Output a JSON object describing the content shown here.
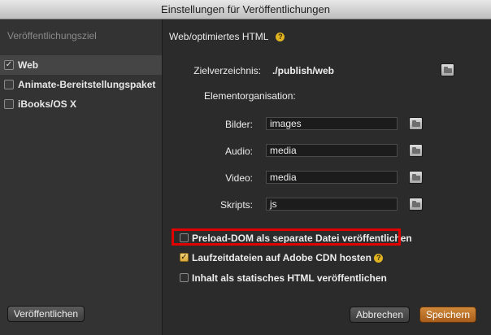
{
  "window": {
    "title": "Einstellungen für Veröffentlichungen"
  },
  "sidebar": {
    "header": "Veröffentlichungsziel",
    "items": [
      {
        "label": "Web",
        "checked": true
      },
      {
        "label": "Animate-Bereitstellungspaket",
        "checked": false
      },
      {
        "label": "iBooks/OS X",
        "checked": false
      }
    ],
    "publish_button": "Veröffentlichen"
  },
  "main": {
    "section_title": "Web/optimiertes HTML",
    "help_glyph": "?",
    "target_dir_label": "Zielverzeichnis:",
    "target_dir_value": "./publish/web",
    "element_org_label": "Elementorganisation:",
    "fields": [
      {
        "label": "Bilder:",
        "value": "images"
      },
      {
        "label": "Audio:",
        "value": "media"
      },
      {
        "label": "Video:",
        "value": "media"
      },
      {
        "label": "Skripts:",
        "value": "js"
      }
    ],
    "options": [
      {
        "label": "Preload-DOM als separate Datei veröffentlichen",
        "checked": false
      },
      {
        "label": "Laufzeitdateien auf Adobe CDN hosten",
        "checked": true
      },
      {
        "label": "Inhalt als statisches HTML veröffentlichen",
        "checked": false
      }
    ],
    "cancel_button": "Abbrechen",
    "save_button": "Speichern"
  },
  "colors": {
    "highlight": "#e00000",
    "accent": "#c67a2e"
  }
}
